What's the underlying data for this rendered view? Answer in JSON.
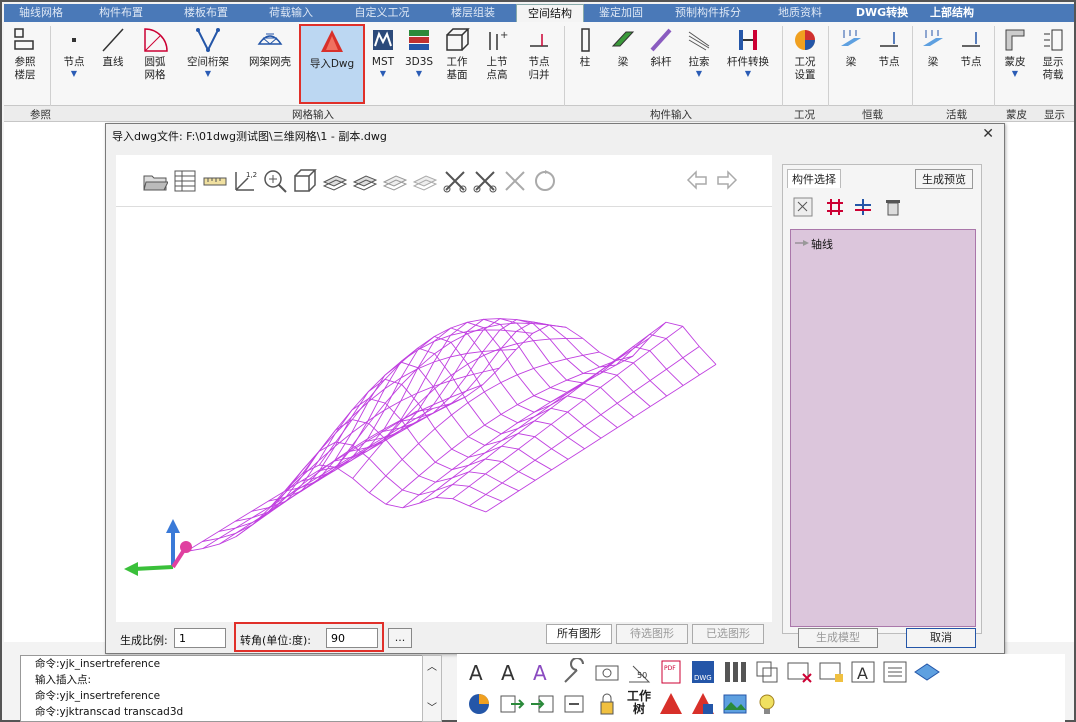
{
  "ribbon_tabs": [
    {
      "label": "轴线网格"
    },
    {
      "label": "构件布置"
    },
    {
      "label": "楼板布置"
    },
    {
      "label": "荷载输入"
    },
    {
      "label": "自定义工况"
    },
    {
      "label": "楼层组装"
    },
    {
      "label": "空间结构",
      "active": true
    },
    {
      "label": "鉴定加固"
    },
    {
      "label": "预制构件拆分"
    },
    {
      "label": "地质资料"
    },
    {
      "label": "DWG转换",
      "highlight": true
    },
    {
      "label": "上部结构",
      "highlight": true
    }
  ],
  "ribbon_buttons": {
    "ref_floor": "参照\n楼层",
    "node": "节点",
    "line": "直线",
    "arc_grid": "圆弧\n网格",
    "space_truss": "空间桁架",
    "grid_shell": "网架网壳",
    "import_dwg": "导入Dwg",
    "mst": "MST",
    "s3d3s": "3D3S",
    "work_plane": "工作\n基面",
    "node_elev": "上节\n点高",
    "node_merge": "节点\n归并",
    "column": "柱",
    "beam": "梁",
    "brace": "斜杆",
    "cable": "拉索",
    "member_convert": "杆件转换",
    "case_setting": "工况\n设置",
    "dead_beam": "梁",
    "dead_node": "节点",
    "live_beam": "梁",
    "live_node": "节点",
    "skin": "蒙皮",
    "show_load": "显示\n荷载"
  },
  "ribbon_groups": {
    "ref": "参照",
    "grid_input": "网格输入",
    "member_input": "构件输入",
    "case": "工况",
    "dead": "恒载",
    "live": "活载",
    "skin": "蒙皮",
    "show": "显示"
  },
  "dialog": {
    "title": "导入dwg文件: F:\\01dwg测试图\\三维网格\\1 - 副本.dwg",
    "panel_tab": "构件选择",
    "preview_button": "生成预览",
    "tree_item": "轴线",
    "scale_label": "生成比例:",
    "scale_value": "1",
    "angle_label": "转角(单位:度):",
    "angle_value": "90",
    "browse_button": "...",
    "view_tabs": [
      "所有图形",
      "待选图形",
      "已选图形"
    ],
    "generate_button": "生成模型",
    "cancel_button": "取消"
  },
  "command_lines": [
    "命令:yjk_insertreference",
    "输入插入点:",
    "命令:yjk_insertreference",
    "命令:yjktranscad transcad3d"
  ],
  "bottom_toolbar": {
    "work_tree_label": "工作\n树"
  },
  "colors": {
    "tab_bar": "#4a79b8",
    "accent_red": "#e0302a",
    "mesh": "#c040e0",
    "panel_list": "#dcc6dc"
  }
}
